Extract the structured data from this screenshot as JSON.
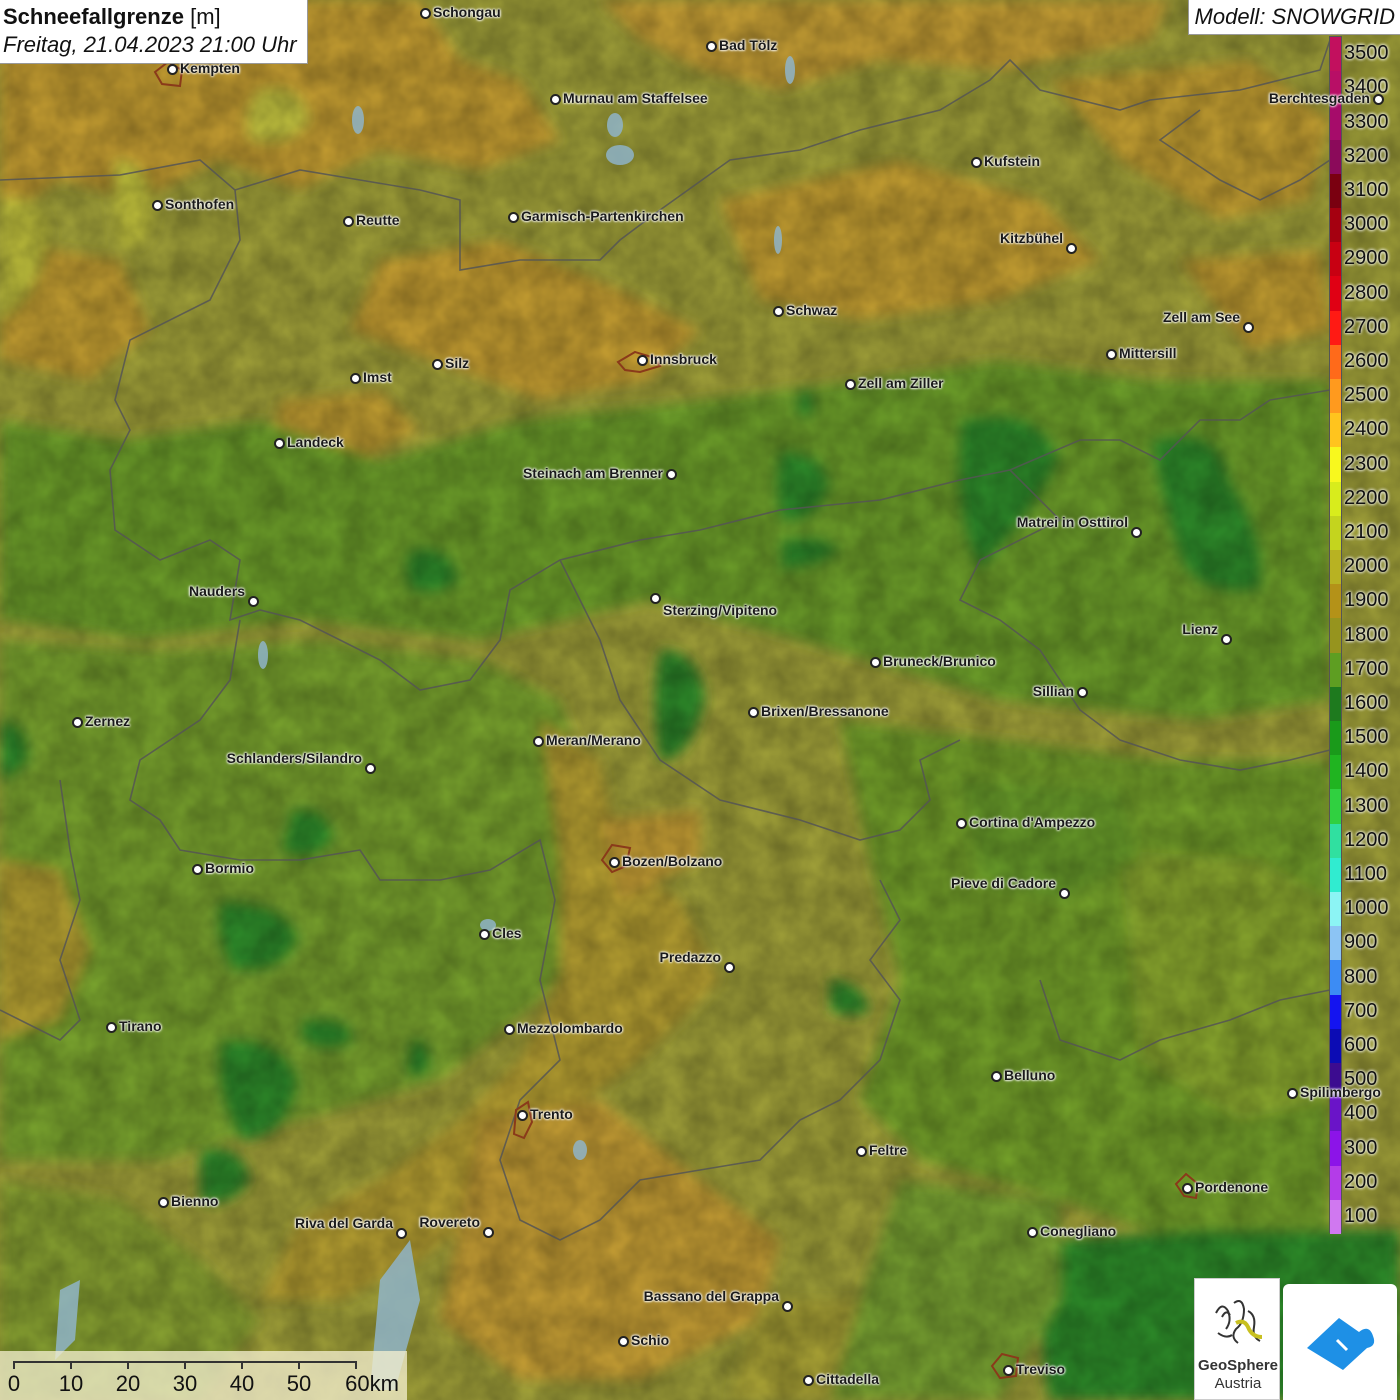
{
  "title": {
    "main": "Schneefallgrenze",
    "unit": "[m]",
    "date": "Freitag, 21.04.2023 21:00 Uhr"
  },
  "model": "Modell: SNOWGRID",
  "legend": {
    "entries": [
      {
        "value": "3500",
        "color": "#c2105e"
      },
      {
        "value": "3400",
        "color": "#b80f66"
      },
      {
        "value": "3300",
        "color": "#a60c6a"
      },
      {
        "value": "3200",
        "color": "#8b0a5a"
      },
      {
        "value": "3100",
        "color": "#7a0010"
      },
      {
        "value": "3000",
        "color": "#a50010"
      },
      {
        "value": "2900",
        "color": "#c80012"
      },
      {
        "value": "2800",
        "color": "#e00014"
      },
      {
        "value": "2700",
        "color": "#ff1a14"
      },
      {
        "value": "2600",
        "color": "#ff6a1a"
      },
      {
        "value": "2500",
        "color": "#ff9a1e"
      },
      {
        "value": "2400",
        "color": "#ffc41e"
      },
      {
        "value": "2300",
        "color": "#f8f81e"
      },
      {
        "value": "2200",
        "color": "#d8ec1c"
      },
      {
        "value": "2100",
        "color": "#c4d41e"
      },
      {
        "value": "2000",
        "color": "#b8b222"
      },
      {
        "value": "1900",
        "color": "#b49218"
      },
      {
        "value": "1800",
        "color": "#96941e"
      },
      {
        "value": "1700",
        "color": "#5e9e22"
      },
      {
        "value": "1600",
        "color": "#1e7a1e"
      },
      {
        "value": "1500",
        "color": "#1a9a1a"
      },
      {
        "value": "1400",
        "color": "#20b420"
      },
      {
        "value": "1300",
        "color": "#30d040"
      },
      {
        "value": "1200",
        "color": "#30e0a0"
      },
      {
        "value": "1100",
        "color": "#30ecd0"
      },
      {
        "value": "1000",
        "color": "#8cf4f4"
      },
      {
        "value": "900",
        "color": "#8cc4f4"
      },
      {
        "value": "800",
        "color": "#3c8cf4"
      },
      {
        "value": "700",
        "color": "#1414f0"
      },
      {
        "value": "600",
        "color": "#0c0cb4"
      },
      {
        "value": "500",
        "color": "#3c0c90"
      },
      {
        "value": "400",
        "color": "#6a14c8"
      },
      {
        "value": "300",
        "color": "#8c14e8"
      },
      {
        "value": "200",
        "color": "#b43ce8"
      },
      {
        "value": "100",
        "color": "#d078f0"
      }
    ]
  },
  "scale": {
    "labels": [
      "0",
      "10",
      "20",
      "30",
      "40",
      "50",
      "60km"
    ]
  },
  "logos": {
    "geosphere_name": "GeoSphere",
    "geosphere_sub": "Austria"
  },
  "cities": [
    {
      "name": "Schongau",
      "side": "right"
    },
    {
      "name": "Bad Tölz",
      "side": "right"
    },
    {
      "name": "Kempten",
      "side": "right"
    },
    {
      "name": "Murnau am Staffelsee",
      "side": "right"
    },
    {
      "name": "Berchtesgaden",
      "side": "left"
    },
    {
      "name": "Kufstein",
      "side": "right"
    },
    {
      "name": "Sonthofen",
      "side": "right"
    },
    {
      "name": "Reutte",
      "side": "right"
    },
    {
      "name": "Garmisch-Partenkirchen",
      "side": "right"
    },
    {
      "name": "Kitzbühel",
      "side": "leftup"
    },
    {
      "name": "Schwaz",
      "side": "right"
    },
    {
      "name": "Zell am See",
      "side": "leftup"
    },
    {
      "name": "Innsbruck",
      "side": "right"
    },
    {
      "name": "Mittersill",
      "side": "right"
    },
    {
      "name": "Imst",
      "side": "right"
    },
    {
      "name": "Silz",
      "side": "right"
    },
    {
      "name": "Zell am Ziller",
      "side": "right"
    },
    {
      "name": "Landeck",
      "side": "right"
    },
    {
      "name": "Steinach am Brenner",
      "side": "left"
    },
    {
      "name": "Matrei in Osttirol",
      "side": "leftup"
    },
    {
      "name": "Nauders",
      "side": "leftup"
    },
    {
      "name": "Sterzing/Vipiteno",
      "side": "rightlow"
    },
    {
      "name": "Lienz",
      "side": "leftup"
    },
    {
      "name": "Bruneck/Brunico",
      "side": "right"
    },
    {
      "name": "Sillian",
      "side": "left"
    },
    {
      "name": "Zernez",
      "side": "right"
    },
    {
      "name": "Brixen/Bressanone",
      "side": "right"
    },
    {
      "name": "Meran/Merano",
      "side": "right"
    },
    {
      "name": "Schlanders/Silandro",
      "side": "leftup"
    },
    {
      "name": "Cortina d'Ampezzo",
      "side": "right"
    },
    {
      "name": "Bozen/Bolzano",
      "side": "right"
    },
    {
      "name": "Bormio",
      "side": "right"
    },
    {
      "name": "Pieve di Cadore",
      "side": "leftup"
    },
    {
      "name": "Cles",
      "side": "right"
    },
    {
      "name": "Predazzo",
      "side": "leftup"
    },
    {
      "name": "Tirano",
      "side": "right"
    },
    {
      "name": "Mezzolombardo",
      "side": "right"
    },
    {
      "name": "Belluno",
      "side": "right"
    },
    {
      "name": "Spilimbergo",
      "side": "right"
    },
    {
      "name": "Trento",
      "side": "right"
    },
    {
      "name": "Feltre",
      "side": "right"
    },
    {
      "name": "Pordenone",
      "side": "right"
    },
    {
      "name": "Bienno",
      "side": "right"
    },
    {
      "name": "Riva del Garda",
      "side": "leftup"
    },
    {
      "name": "Rovereto",
      "side": "leftup"
    },
    {
      "name": "Conegliano",
      "side": "right"
    },
    {
      "name": "Bassano del Grappa",
      "side": "leftup"
    },
    {
      "name": "Schio",
      "side": "right"
    },
    {
      "name": "Treviso",
      "side": "right"
    },
    {
      "name": "Cittadella",
      "side": "right"
    }
  ]
}
